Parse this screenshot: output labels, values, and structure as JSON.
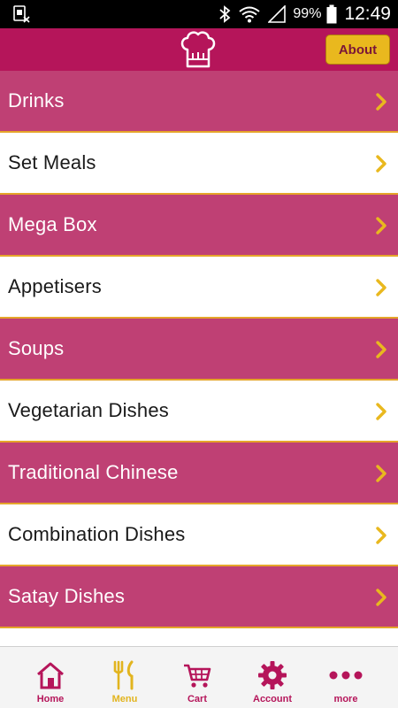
{
  "status_bar": {
    "battery": "99%",
    "time": "12:49",
    "icons": [
      "sim-card-icon",
      "bluetooth-icon",
      "wifi-icon",
      "signal-icon",
      "battery-icon"
    ]
  },
  "header": {
    "logo_icon": "chef-hat-icon",
    "about_label": "About"
  },
  "colors": {
    "header": "#b5155a",
    "pink_row": "#bf4074",
    "accent": "#e9b81e",
    "divider": "#e5a52a"
  },
  "menu": {
    "items": [
      {
        "label": "Drinks"
      },
      {
        "label": "Set Meals"
      },
      {
        "label": "Mega Box"
      },
      {
        "label": "Appetisers"
      },
      {
        "label": "Soups"
      },
      {
        "label": "Vegetarian Dishes"
      },
      {
        "label": "Traditional Chinese"
      },
      {
        "label": "Combination Dishes"
      },
      {
        "label": "Satay Dishes"
      }
    ]
  },
  "bottom_nav": {
    "active": "Menu",
    "items": [
      {
        "label": "Home",
        "icon": "home-icon"
      },
      {
        "label": "Menu",
        "icon": "fork-knife-icon"
      },
      {
        "label": "Cart",
        "icon": "cart-icon"
      },
      {
        "label": "Account",
        "icon": "gear-icon"
      },
      {
        "label": "more",
        "icon": "more-dots-icon"
      }
    ]
  }
}
